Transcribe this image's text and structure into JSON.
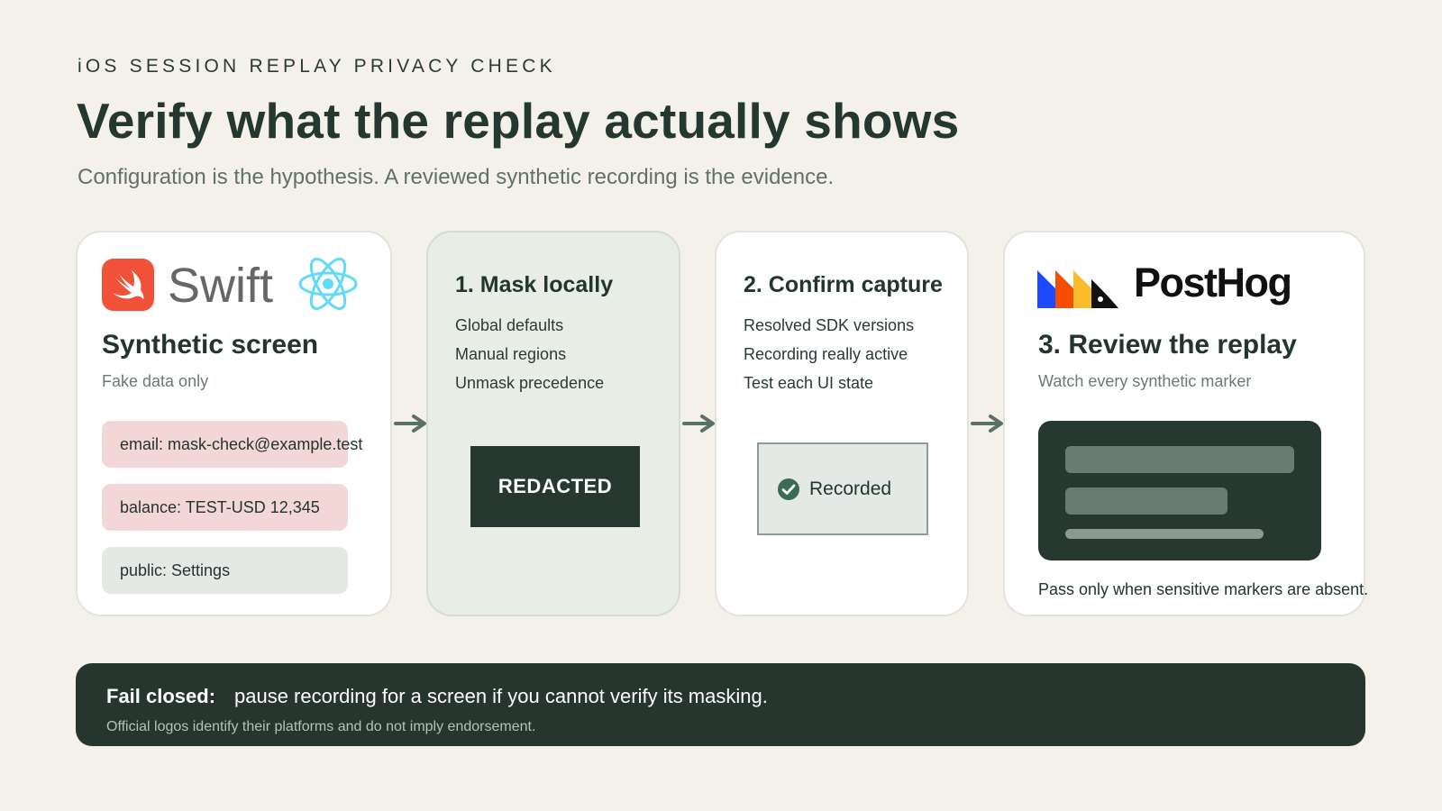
{
  "header": {
    "eyebrow": "iOS SESSION REPLAY PRIVACY CHECK",
    "title": "Verify what the replay actually shows",
    "subtitle": "Configuration is the hypothesis. A reviewed synthetic recording is the evidence."
  },
  "cards": {
    "synthetic": {
      "logo_text": "Swift",
      "heading": "Synthetic screen",
      "sub": "Fake data only",
      "chips": [
        "email: mask-check@example.test",
        "balance: TEST-USD 12,345",
        "public: Settings"
      ]
    },
    "mask": {
      "heading": "1. Mask locally",
      "items": [
        "Global defaults",
        "Manual regions",
        "Unmask precedence"
      ],
      "badge": "REDACTED"
    },
    "capture": {
      "heading": "2. Confirm capture",
      "items": [
        "Resolved SDK versions",
        "Recording really active",
        "Test each UI state"
      ],
      "badge": "Recorded"
    },
    "review": {
      "logo_text": "PostHog",
      "heading": "3. Review the replay",
      "sub": "Watch every synthetic marker",
      "note": "Pass only when sensitive markers are absent."
    }
  },
  "banner": {
    "lead": "Fail closed:",
    "text": "pause recording for a screen if you cannot verify its masking.",
    "note": "Official logos identify their platforms and do not imply endorsement."
  },
  "colors": {
    "background": "#f4f1ea",
    "dark_green": "#26382f",
    "sensitive_chip": "#f3d6d6",
    "public_chip": "#e4e9e5",
    "swift_orange": "#f05138",
    "react_cyan": "#61dafb"
  },
  "icons": [
    "swift-logo-icon",
    "react-logo-icon",
    "arrow-right-icon",
    "check-circle-icon",
    "posthog-logo-icon"
  ]
}
